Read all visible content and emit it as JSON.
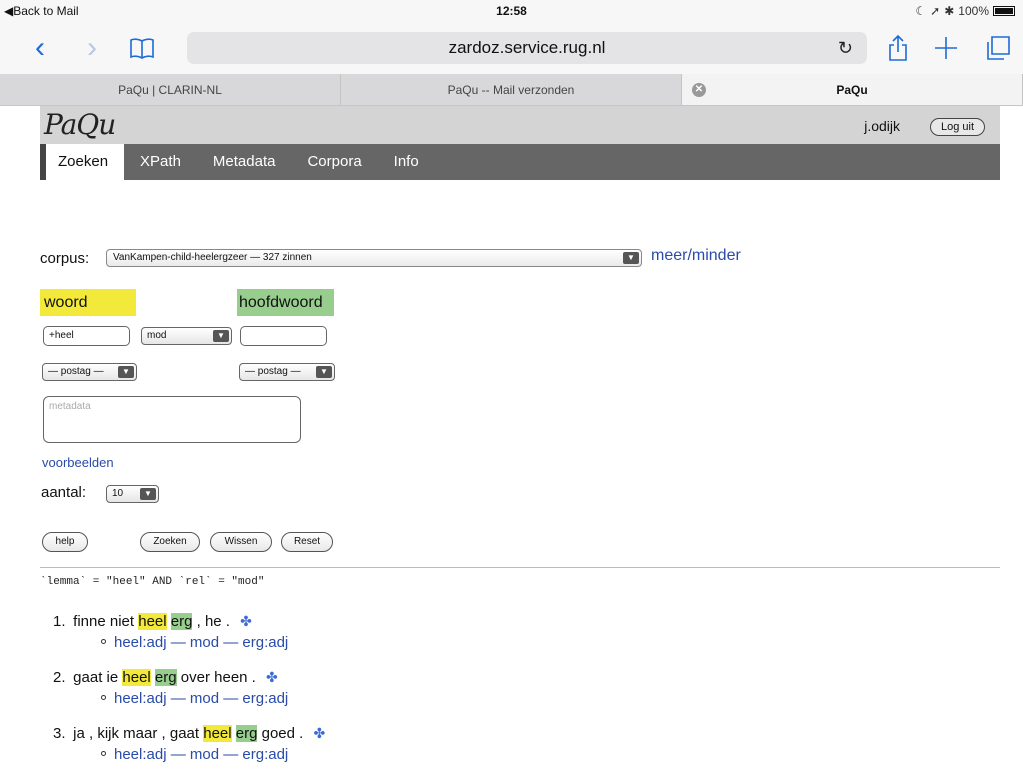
{
  "status_bar": {
    "back_label": "◀Back to Mail",
    "time": "12:58",
    "battery": "100%"
  },
  "browser": {
    "url": "zardoz.service.rug.nl",
    "tabs": [
      {
        "label": "PaQu | CLARIN-NL",
        "active": false
      },
      {
        "label": "PaQu -- Mail verzonden",
        "active": false
      },
      {
        "label": "PaQu",
        "active": true
      }
    ]
  },
  "site": {
    "logo": "PaQu",
    "user": "j.odijk",
    "logout_label": "Log uit",
    "nav": [
      "Zoeken",
      "XPath",
      "Metadata",
      "Corpora",
      "Info"
    ]
  },
  "form": {
    "corpus_label": "corpus:",
    "corpus_value": "VanKampen-child-heelergzeer — 327 zinnen",
    "meer_minder": "meer/minder",
    "woord_label": "woord",
    "hoofdwoord_label": "hoofdwoord",
    "woord_value": "+heel",
    "rel_value": "mod",
    "hoofdwoord_value": "",
    "postag_woord": "— postag —",
    "postag_hoofdwoord": "— postag —",
    "metadata_placeholder": "metadata",
    "voorbeelden": "voorbeelden",
    "aantal_label": "aantal:",
    "aantal_value": "10",
    "buttons": {
      "help": "help",
      "zoeken": "Zoeken",
      "wissen": "Wissen",
      "reset": "Reset"
    }
  },
  "query": "`lemma` = \"heel\" AND `rel` = \"mod\"",
  "results": [
    {
      "num": "1.",
      "before": "finne niet",
      "word": "heel",
      "head": "erg",
      "after": ", he .",
      "relation": "heel:adj — mod — erg:adj"
    },
    {
      "num": "2.",
      "before": "gaat ie",
      "word": "heel",
      "head": "erg",
      "after": "over heen .",
      "relation": "heel:adj — mod — erg:adj"
    },
    {
      "num": "3.",
      "before": "ja , kijk maar , gaat",
      "word": "heel",
      "head": "erg",
      "after": "goed .",
      "relation": "heel:adj — mod — erg:adj"
    }
  ]
}
